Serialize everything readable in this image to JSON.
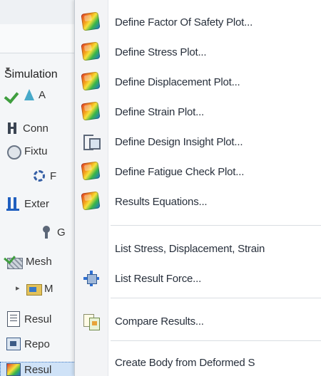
{
  "tree": {
    "dropdown_arrow": "▾",
    "study_label": "Simulation",
    "rows": [
      {
        "icon": "check-flask",
        "label": "A"
      },
      {
        "icon": "connections-icon",
        "label": "Conn"
      },
      {
        "icon": "fixtures-icon",
        "label": "Fixtu"
      },
      {
        "icon": "fixture-item-icon",
        "label": "F"
      },
      {
        "icon": "external-loads-icon",
        "label": "Exter"
      },
      {
        "icon": "load-item-icon",
        "label": "G"
      },
      {
        "icon": "mesh-icon",
        "label": "Mesh"
      },
      {
        "icon": "folder-icon",
        "label": "M"
      },
      {
        "icon": "result-options-icon",
        "label": "Resul"
      },
      {
        "icon": "report-icon",
        "label": "Repo"
      },
      {
        "icon": "results-icon",
        "label": "Resul"
      }
    ]
  },
  "menu": {
    "items": [
      {
        "name": "define-factor-of-safety-plot",
        "icon": "plot-icon",
        "label": "Define Factor Of Safety Plot..."
      },
      {
        "name": "define-stress-plot",
        "icon": "plot-icon",
        "label": "Define Stress Plot..."
      },
      {
        "name": "define-displacement-plot",
        "icon": "plot-icon",
        "label": "Define Displacement Plot..."
      },
      {
        "name": "define-strain-plot",
        "icon": "plot-icon",
        "label": "Define Strain Plot..."
      },
      {
        "name": "define-design-insight-plot",
        "icon": "design-insight-icon",
        "label": "Define Design Insight Plot..."
      },
      {
        "name": "define-fatigue-check-plot",
        "icon": "plot-icon",
        "label": "Define Fatigue Check Plot..."
      },
      {
        "name": "results-equations",
        "icon": "plot-icon",
        "label": "Results Equations..."
      },
      {
        "name": "list-stress-displacement-strain",
        "icon": "",
        "label": "List Stress, Displacement, Strain"
      },
      {
        "name": "list-result-force",
        "icon": "result-force-icon",
        "label": "List Result Force..."
      },
      {
        "name": "compare-results",
        "icon": "compare-results-icon",
        "label": "Compare Results..."
      },
      {
        "name": "create-body-from-deformed-shape",
        "icon": "",
        "label": "Create Body from Deformed S"
      }
    ]
  }
}
